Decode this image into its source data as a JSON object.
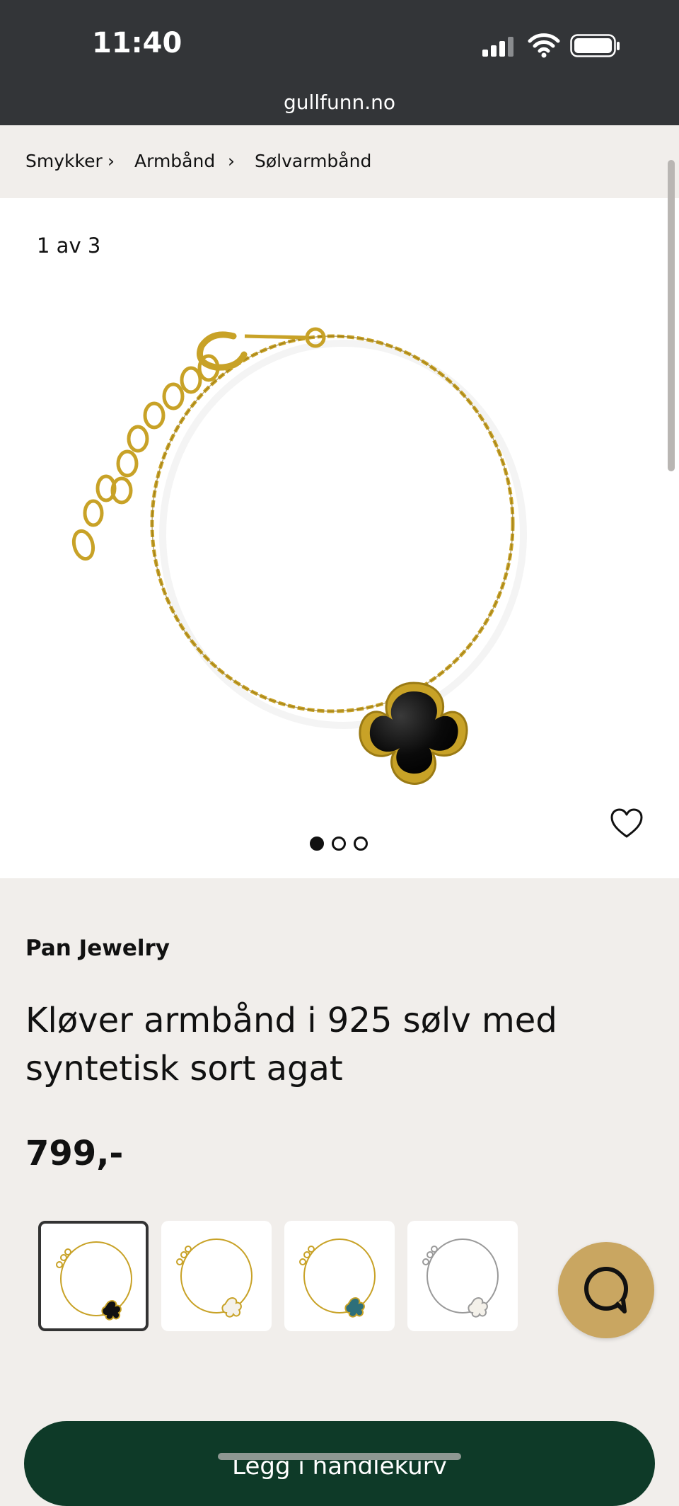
{
  "status_bar": {
    "time": "11:40"
  },
  "browser": {
    "url": "gullfunn.no"
  },
  "breadcrumb": {
    "items": [
      "Smykker",
      "Armbånd",
      "Sølvarmbånd"
    ],
    "separator": "›"
  },
  "gallery": {
    "counter": "1 av 3",
    "total_images": 3,
    "active_index": 0
  },
  "product": {
    "brand": "Pan Jewelry",
    "title": "Kløver armbånd i 925 sølv med syntetisk sort agat",
    "price": "799,-"
  },
  "variants": [
    {
      "name": "black",
      "metal": "gold",
      "stone": "#111111",
      "selected": true
    },
    {
      "name": "white",
      "metal": "gold",
      "stone": "#f4f1ea",
      "selected": false
    },
    {
      "name": "abalone",
      "metal": "gold",
      "stone": "#2e6f7a",
      "selected": false
    },
    {
      "name": "white-silver",
      "metal": "silver",
      "stone": "#f4f1ea",
      "selected": false
    }
  ],
  "cart": {
    "label": "Legg i handlekurv"
  },
  "colors": {
    "brand_gold": "#c9a661",
    "cta_green": "#0e3a28",
    "status_bar": "#333538"
  },
  "icons": [
    "signal-icon",
    "wifi-icon",
    "battery-icon",
    "heart-icon",
    "chat-icon"
  ]
}
